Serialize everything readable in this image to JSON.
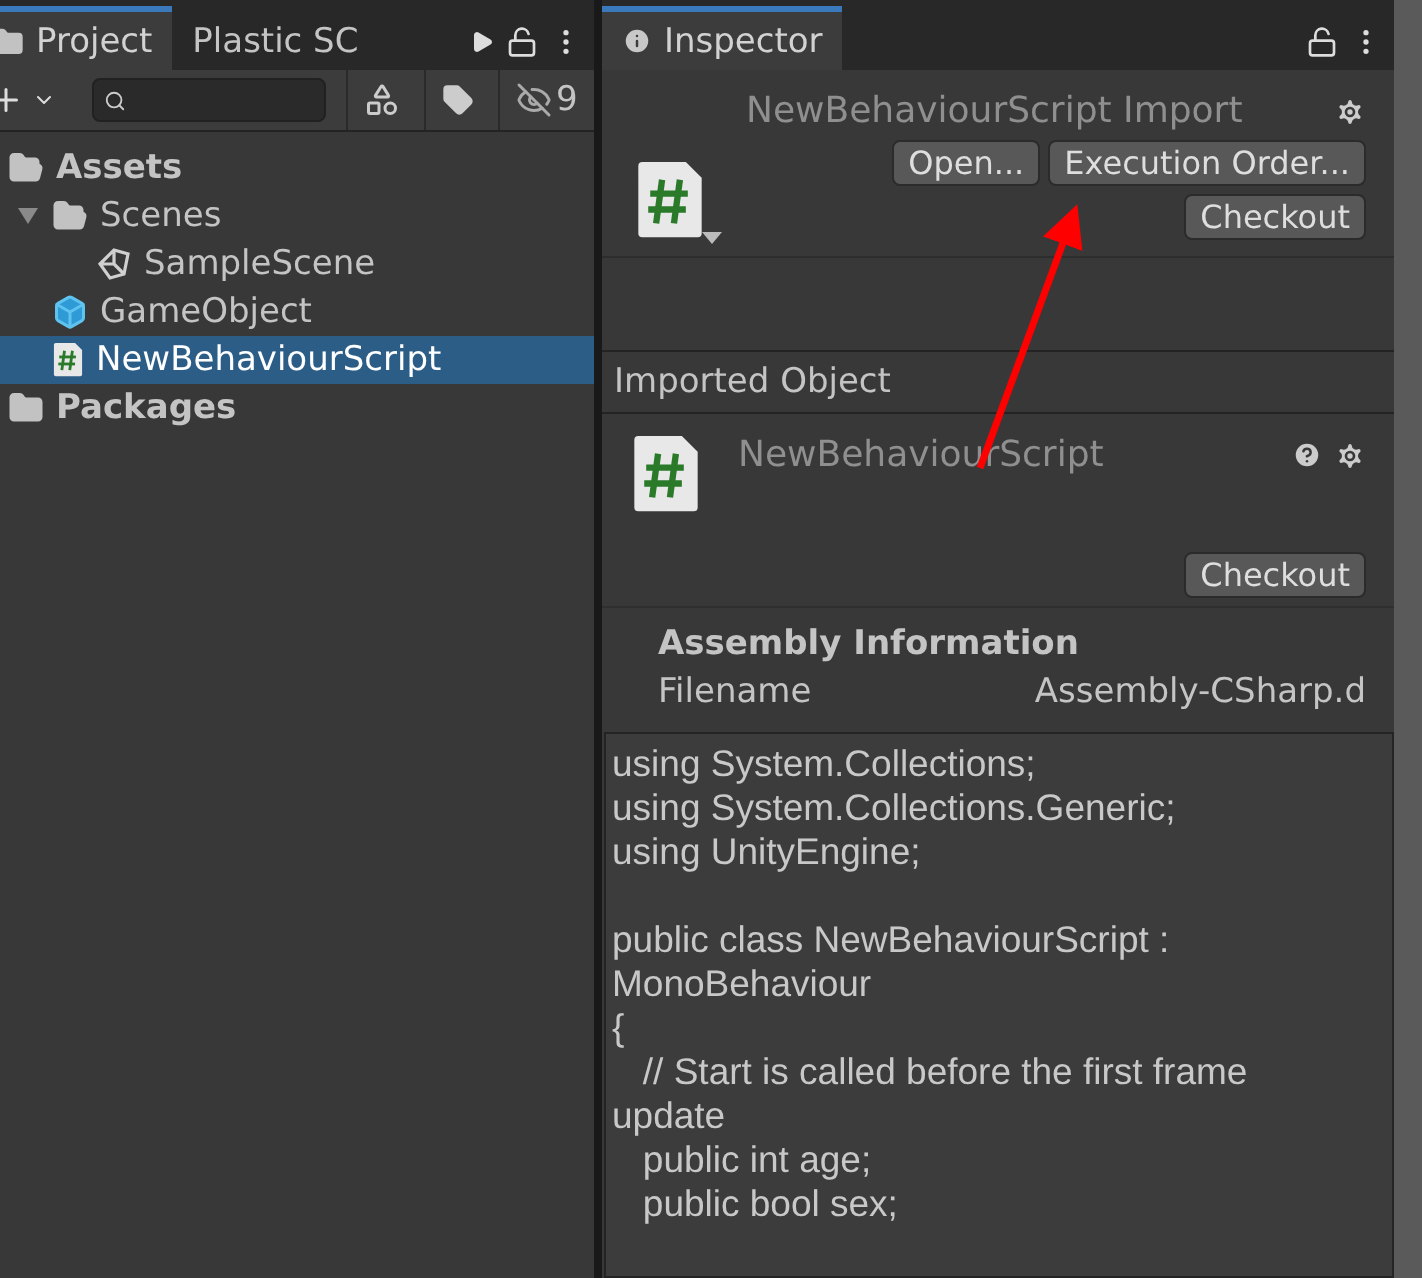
{
  "project_panel": {
    "tabs": [
      {
        "label": "Project",
        "selected": true
      },
      {
        "label": "Plastic SC",
        "selected": false
      }
    ],
    "toolbar": {
      "hidden_count": "9"
    },
    "tree": [
      {
        "label": "Assets",
        "kind": "folder",
        "expanded": true,
        "selected": false,
        "children": [
          {
            "label": "Scenes",
            "kind": "folder",
            "expanded": true,
            "selected": false,
            "children": [
              {
                "label": "SampleScene",
                "kind": "scene",
                "selected": false
              }
            ]
          },
          {
            "label": "GameObject",
            "kind": "prefab",
            "selected": false
          },
          {
            "label": "NewBehaviourScript",
            "kind": "script",
            "selected": true
          }
        ]
      },
      {
        "label": "Packages",
        "kind": "folder",
        "expanded": false,
        "selected": false
      }
    ]
  },
  "inspector": {
    "tab": {
      "label": "Inspector",
      "selected": true
    },
    "header": {
      "title": "NewBehaviourScript Import",
      "buttons": [
        "Open...",
        "Execution Order..."
      ],
      "checkout": "Checkout"
    },
    "section_title": "Imported Object",
    "object": {
      "title": "NewBehaviourScript",
      "checkout": "Checkout"
    },
    "assembly": {
      "heading": "Assembly Information",
      "label": "Filename",
      "value": "Assembly-CSharp.d"
    },
    "code": [
      [
        "using System.Collections;",
        "using System.Collections.Generic;",
        "using UnityEngine;"
      ],
      [
        "public class NewBehaviourScript :",
        "MonoBehaviour",
        "{",
        "   // Start is called before the first frame",
        "update",
        "   public int age;",
        "   public bool sex;"
      ]
    ]
  },
  "annotation": {
    "kind": "arrow",
    "color": "#ff0000"
  }
}
